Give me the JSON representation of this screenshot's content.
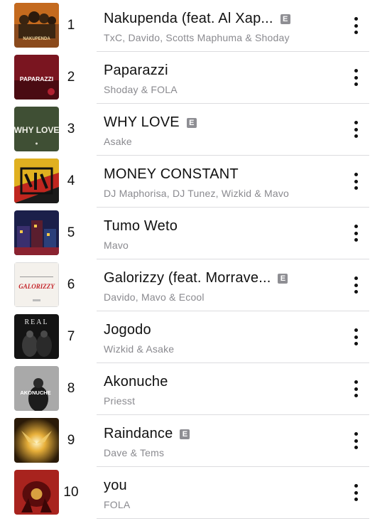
{
  "tracks": [
    {
      "rank": "1",
      "title": "Nakupenda (feat. Al Xap...",
      "explicit": "E",
      "artist": "TxC, Davido, Scotts Maphuma & Shoday"
    },
    {
      "rank": "2",
      "title": "Paparazzi",
      "explicit": "",
      "artist": "Shoday & FOLA"
    },
    {
      "rank": "3",
      "title": "WHY LOVE",
      "explicit": "E",
      "artist": "Asake"
    },
    {
      "rank": "4",
      "title": "MONEY CONSTANT",
      "explicit": "",
      "artist": "DJ Maphorisa, DJ Tunez, Wizkid & Mavo"
    },
    {
      "rank": "5",
      "title": "Tumo Weto",
      "explicit": "",
      "artist": "Mavo"
    },
    {
      "rank": "6",
      "title": "Galorizzy (feat. Morrave...",
      "explicit": "E",
      "artist": "Davido, Mavo & Ecool"
    },
    {
      "rank": "7",
      "title": "Jogodo",
      "explicit": "",
      "artist": "Wizkid & Asake"
    },
    {
      "rank": "8",
      "title": "Akonuche",
      "explicit": "",
      "artist": "Priesst"
    },
    {
      "rank": "9",
      "title": "Raindance",
      "explicit": "E",
      "artist": "Dave & Tems"
    },
    {
      "rank": "10",
      "title": "you",
      "explicit": "",
      "artist": "FOLA"
    }
  ],
  "artwork_text": {
    "art1": "NAKUPENDA",
    "art2": "PAPARAZZI",
    "art3": "WHY LOVE",
    "art6": "GALORIZZY",
    "art7": "REAL",
    "art8": "AKONUCHE"
  },
  "colors": {
    "explicit_badge": "#8e8e93",
    "secondary_text": "#8a8a8f",
    "separator": "#dcdcdf"
  }
}
